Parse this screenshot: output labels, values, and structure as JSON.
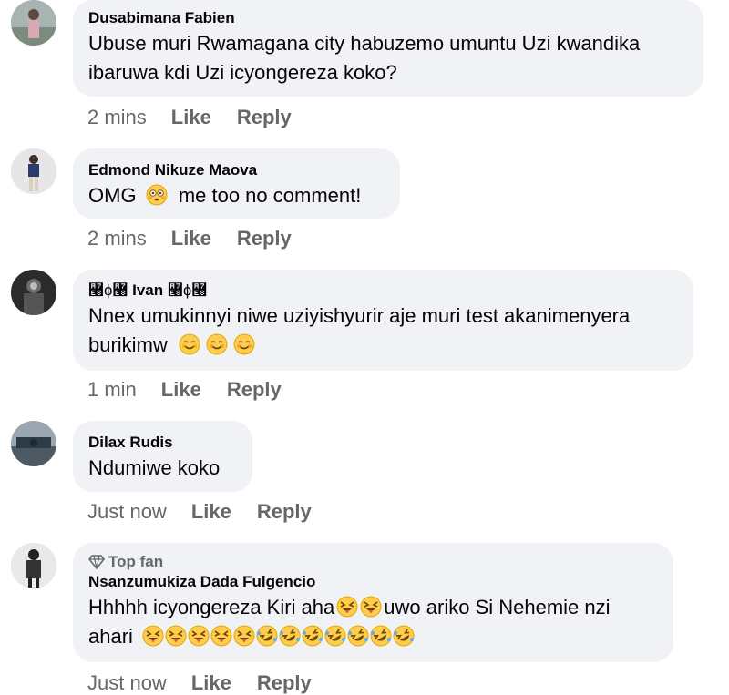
{
  "comments": [
    {
      "author": "Dusabimana Fabien",
      "badge": "",
      "lines": [
        "Ubuse muri Rwamagana city habuzemo umuntu Uzi kwandika",
        "ibaruwa kdi Uzi icyongereza koko?"
      ],
      "time": "2 mins",
      "like": "Like",
      "reply": "Reply"
    },
    {
      "author": "Edmond Nikuze Maova",
      "badge": "",
      "text_a": "OMG",
      "text_b": "me too no comment!",
      "emoji": "flushed-face",
      "time": "2 mins",
      "like": "Like",
      "reply": "Reply"
    },
    {
      "author": "Ivan",
      "author_decor": "꟨ɸ꟨",
      "badge": "",
      "line1": "Nnex umukinnyi niwe uziyishyurir aje muri test akanimenyera",
      "line2": "burikimw",
      "emoji": "smiling-face",
      "time": "1 min",
      "like": "Like",
      "reply": "Reply"
    },
    {
      "author": "Dilax Rudis",
      "badge": "",
      "text": "Ndumiwe koko",
      "time": "Just now",
      "like": "Like",
      "reply": "Reply"
    },
    {
      "author": "Nsanzumukiza Dada Fulgencio",
      "badge": "Top fan",
      "line1_a": "Hhhhh icyongereza Kiri aha",
      "line1_b": "uwo ariko Si Nehemie nzi",
      "line2": "ahari",
      "emoji_a": "squinting-tongue-face",
      "emoji_b": "rolling-laughing-face",
      "time": "Just now",
      "like": "Like",
      "reply": "Reply"
    }
  ],
  "colors": {
    "bubble": "#f0f2f5",
    "meta": "#65676b",
    "text": "#050505"
  }
}
